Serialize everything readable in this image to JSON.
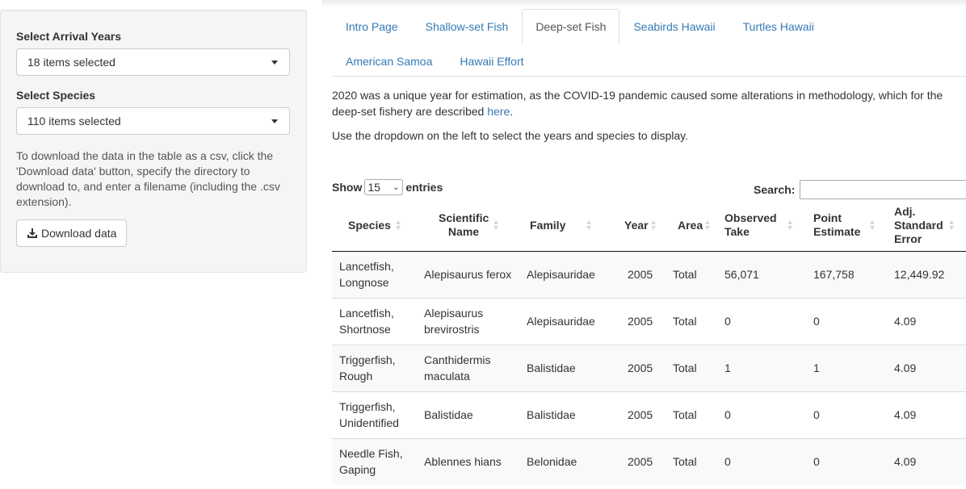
{
  "sidebar": {
    "years_label": "Select Arrival Years",
    "years_value": "18 items selected",
    "species_label": "Select Species",
    "species_value": "110 items selected",
    "help_text": "To download the data in the table as a csv, click the 'Download data' button, specify the directory to download to, and enter a filename (including the .csv extension).",
    "download_label": "Download data"
  },
  "tabs": [
    {
      "label": "Intro Page"
    },
    {
      "label": "Shallow-set Fish"
    },
    {
      "label": "Deep-set Fish"
    },
    {
      "label": "Seabirds Hawaii"
    },
    {
      "label": "Turtles Hawaii"
    },
    {
      "label": "American Samoa"
    },
    {
      "label": "Hawaii Effort"
    }
  ],
  "active_tab": "Deep-set Fish",
  "content": {
    "para1_text": "2020 was a unique year for estimation, as the COVID-19 pandemic caused some alterations in methodology, which for the deep-set fishery are described ",
    "para1_link": "here",
    "para1_end": ".",
    "para2": "Use the dropdown on the left to select the years and species to display."
  },
  "table_controls": {
    "show_label": "Show",
    "entries_value": "15",
    "entries_label": "entries",
    "search_label": "Search:",
    "search_value": ""
  },
  "table": {
    "headers": [
      "Species",
      "Scientific Name",
      "Family",
      "Year",
      "Area",
      "Observed Take",
      "Point Estimate",
      "Adj. Standard Error"
    ],
    "rows": [
      [
        "Lancetfish, Longnose",
        "Alepisaurus ferox",
        "Alepisauridae",
        "2005",
        "Total",
        "56,071",
        "167,758",
        "12,449.92"
      ],
      [
        "Lancetfish, Shortnose",
        "Alepisaurus brevirostris",
        "Alepisauridae",
        "2005",
        "Total",
        "0",
        "0",
        "4.09"
      ],
      [
        "Triggerfish, Rough",
        "Canthidermis maculata",
        "Balistidae",
        "2005",
        "Total",
        "1",
        "1",
        "4.09"
      ],
      [
        "Triggerfish, Unidentified",
        "Balistidae",
        "Balistidae",
        "2005",
        "Total",
        "0",
        "0",
        "4.09"
      ],
      [
        "Needle Fish, Gaping",
        "Ablennes hians",
        "Belonidae",
        "2005",
        "Total",
        "0",
        "0",
        "4.09"
      ]
    ]
  },
  "colors": {
    "link": "#337ab7",
    "sidebar_bg": "#f5f5f5",
    "stripe": "#f9f9f9"
  }
}
